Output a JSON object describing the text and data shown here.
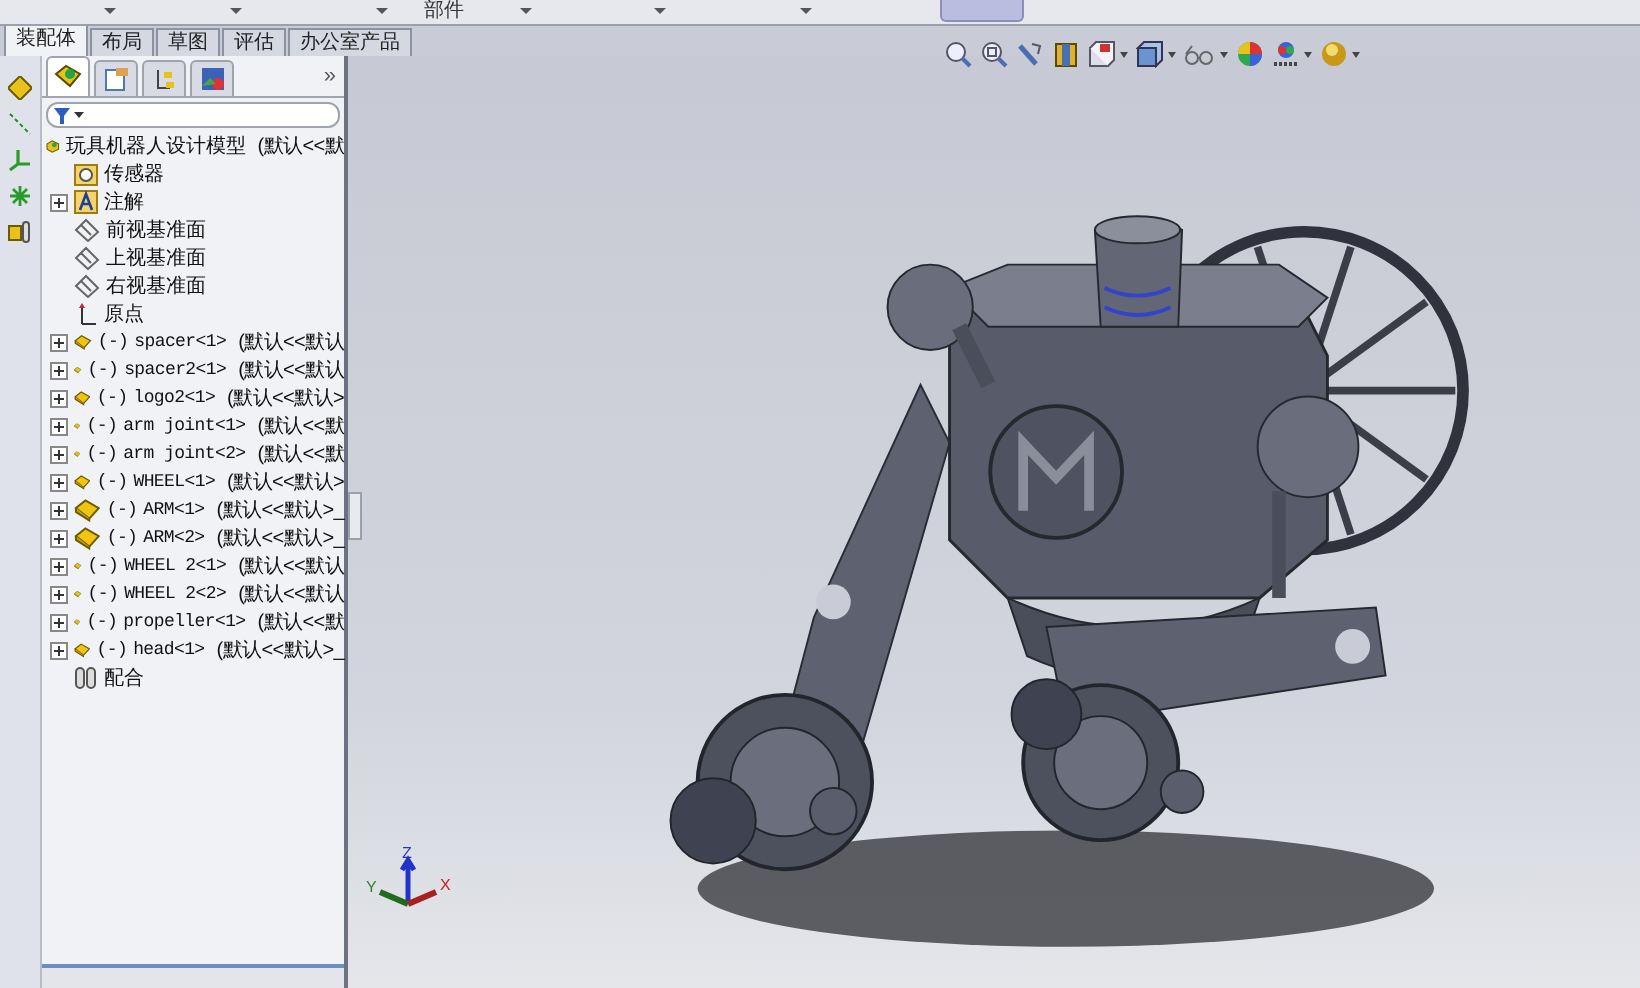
{
  "top_strip": {
    "label": "部件"
  },
  "tabs": [
    {
      "label": "装配体",
      "selected": true
    },
    {
      "label": "布局",
      "selected": false
    },
    {
      "label": "草图",
      "selected": false
    },
    {
      "label": "评估",
      "selected": false
    },
    {
      "label": "办公室产品",
      "selected": false
    }
  ],
  "panel_tabs": [
    {
      "kind": "tree",
      "selected": true
    },
    {
      "kind": "property",
      "selected": false
    },
    {
      "kind": "config",
      "selected": false
    },
    {
      "kind": "display",
      "selected": false
    }
  ],
  "panel_more": "»",
  "tree": {
    "root": {
      "name": "玩具机器人设计模型",
      "config": "(默认<<默"
    },
    "items": [
      {
        "kind": "sensor",
        "name": "传感器",
        "expandable": false
      },
      {
        "kind": "annotation",
        "name": "注解",
        "expandable": true
      },
      {
        "kind": "plane",
        "name": "前视基准面",
        "expandable": false
      },
      {
        "kind": "plane",
        "name": "上视基准面",
        "expandable": false
      },
      {
        "kind": "plane",
        "name": "右视基准面",
        "expandable": false
      },
      {
        "kind": "origin",
        "name": "原点",
        "expandable": false
      },
      {
        "kind": "part",
        "prefix": "(-)",
        "name": "spacer<1>",
        "config": "(默认<<默认",
        "expandable": true
      },
      {
        "kind": "part",
        "prefix": "(-)",
        "name": "spacer2<1>",
        "config": "(默认<<默认",
        "expandable": true
      },
      {
        "kind": "part",
        "prefix": "(-)",
        "name": "logo2<1>",
        "config": "(默认<<默认>",
        "expandable": true
      },
      {
        "kind": "part",
        "prefix": "(-)",
        "name": "arm joint<1>",
        "config": "(默认<<默",
        "expandable": true
      },
      {
        "kind": "part",
        "prefix": "(-)",
        "name": "arm joint<2>",
        "config": "(默认<<默",
        "expandable": true
      },
      {
        "kind": "part",
        "prefix": "(-)",
        "name": "WHEEL<1>",
        "config": "(默认<<默认>",
        "expandable": true
      },
      {
        "kind": "part",
        "prefix": "(-)",
        "name": "ARM<1>",
        "config": "(默认<<默认>_",
        "expandable": true
      },
      {
        "kind": "part",
        "prefix": "(-)",
        "name": "ARM<2>",
        "config": "(默认<<默认>_",
        "expandable": true
      },
      {
        "kind": "part",
        "prefix": "(-)",
        "name": "WHEEL 2<1>",
        "config": "(默认<<默认",
        "expandable": true
      },
      {
        "kind": "part",
        "prefix": "(-)",
        "name": "WHEEL 2<2>",
        "config": "(默认<<默认",
        "expandable": true
      },
      {
        "kind": "part",
        "prefix": "(-)",
        "name": "propeller<1>",
        "config": "(默认<<默",
        "expandable": true
      },
      {
        "kind": "part",
        "prefix": "(-)",
        "name": "head<1>",
        "config": "(默认<<默认>_",
        "expandable": true
      },
      {
        "kind": "mates",
        "name": "配合",
        "expandable": false
      }
    ]
  },
  "triad": {
    "x": "X",
    "y": "Y",
    "z": "Z"
  }
}
